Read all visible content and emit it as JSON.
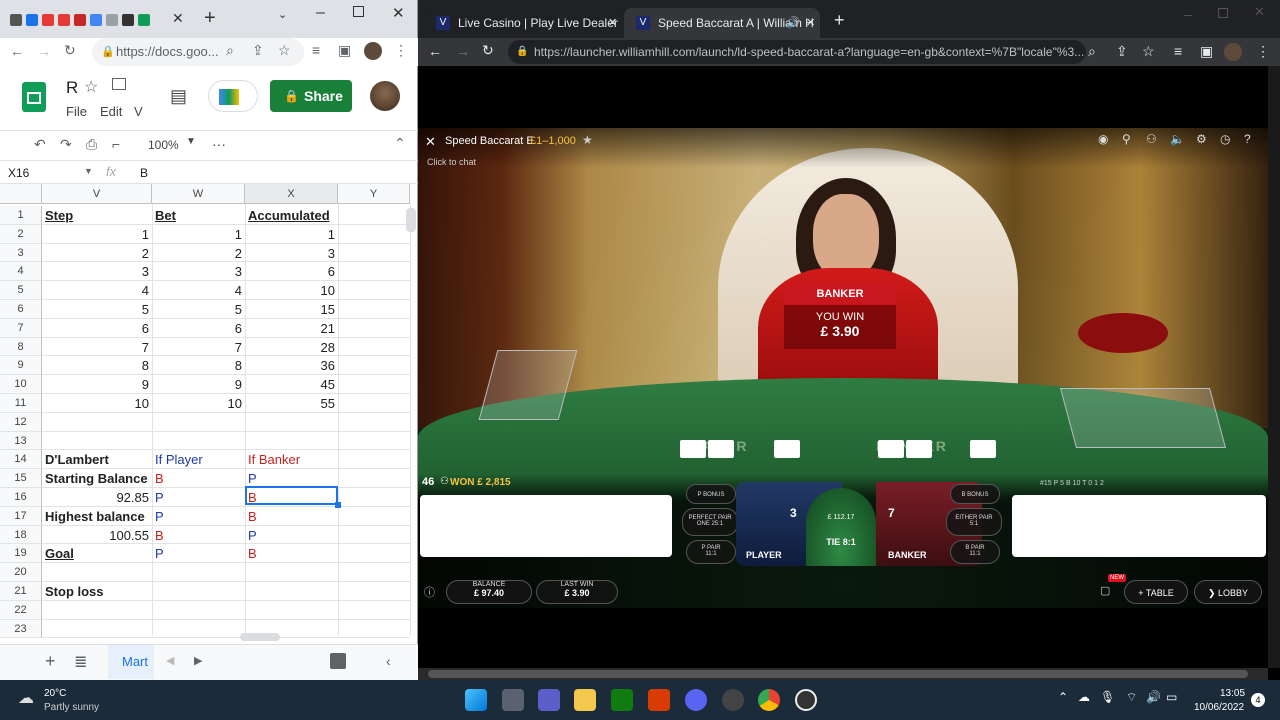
{
  "left_browser": {
    "url": "https://docs.goo...",
    "doc_title": "R",
    "menu": {
      "file": "File",
      "edit": "Edit",
      "more": "V"
    },
    "share_label": "Share",
    "zoom": "100%",
    "more_dots": "···",
    "name_box": "X16",
    "fx": "fx",
    "formula_value": "B",
    "sheet_tab": "Mart"
  },
  "sheet": {
    "columns": [
      "V",
      "W",
      "X",
      "Y"
    ],
    "rows": [
      {
        "n": "1",
        "v": "Step",
        "w": "Bet",
        "x": "Accumulated"
      },
      {
        "n": "2",
        "v": "1",
        "w": "1",
        "x": "1"
      },
      {
        "n": "3",
        "v": "2",
        "w": "2",
        "x": "3"
      },
      {
        "n": "4",
        "v": "3",
        "w": "3",
        "x": "6"
      },
      {
        "n": "5",
        "v": "4",
        "w": "4",
        "x": "10"
      },
      {
        "n": "6",
        "v": "5",
        "w": "5",
        "x": "15"
      },
      {
        "n": "7",
        "v": "6",
        "w": "6",
        "x": "21"
      },
      {
        "n": "8",
        "v": "7",
        "w": "7",
        "x": "28"
      },
      {
        "n": "9",
        "v": "8",
        "w": "8",
        "x": "36"
      },
      {
        "n": "10",
        "v": "9",
        "w": "9",
        "x": "45"
      },
      {
        "n": "11",
        "v": "10",
        "w": "10",
        "x": "55"
      },
      {
        "n": "12",
        "v": "",
        "w": "",
        "x": ""
      },
      {
        "n": "13",
        "v": "",
        "w": "",
        "x": ""
      },
      {
        "n": "14",
        "v": "D'Lambert",
        "w": "If Player",
        "x": "If Banker"
      },
      {
        "n": "15",
        "v": "Starting Balance",
        "w": "B",
        "x": "P"
      },
      {
        "n": "16",
        "v": "92.85",
        "w": "P",
        "x": "B"
      },
      {
        "n": "17",
        "v": "Highest balance",
        "w": "P",
        "x": "B"
      },
      {
        "n": "18",
        "v": "100.55",
        "w": "B",
        "x": "P"
      },
      {
        "n": "19",
        "v": "Goal",
        "w": "P",
        "x": "B"
      },
      {
        "n": "20",
        "v": "",
        "w": "",
        "x": ""
      },
      {
        "n": "21",
        "v": "Stop loss",
        "w": "",
        "x": ""
      },
      {
        "n": "22",
        "v": "",
        "w": "",
        "x": ""
      },
      {
        "n": "23",
        "v": "",
        "w": "",
        "x": ""
      }
    ]
  },
  "right_browser": {
    "tab1": "Live Casino | Play Live Dealer Cas",
    "tab2": "Speed Baccarat A | William H",
    "url": "https://launcher.williamhill.com/launch/ld-speed-baccarat-a?language=en-gb&context=%7B\"locale\"%3..."
  },
  "game": {
    "table_title": "Speed Baccarat E",
    "limits": "£1–1,000",
    "click_chat": "Click to chat",
    "result_label": "BANKER",
    "you_win": "YOU WIN",
    "win_amount": "£ 3.90",
    "won_count": "46",
    "won_label": "WON £ 2,815",
    "player_score": "3",
    "banker_score": "7",
    "player_label": "PLAYER",
    "banker_label": "BANKER",
    "tie_label": "TIE 8:1",
    "tie_amount": "£ 112.17",
    "p_bonus": "P BONUS",
    "b_bonus": "B BONUS",
    "perfect_pair": "PERFECT PAIR",
    "perfect_pair_odds": "ONE 25:1",
    "either_pair": "EITHER PAIR",
    "either_pair_odds": "5:1",
    "p_pair": "P PAIR",
    "p_pair_odds": "11:1",
    "b_pair": "B PAIR",
    "b_pair_odds": "11:1",
    "stats": "#15  P 5  B 10  T 0  1  2",
    "balance_label": "BALANCE",
    "balance_value": "£ 97.40",
    "last_win_label": "LAST WIN",
    "last_win_value": "£ 3.90",
    "new_badge": "NEW",
    "table_btn": "TABLE",
    "lobby_btn": "LOBBY"
  },
  "taskbar": {
    "temp": "20°C",
    "weather": "Partly sunny",
    "time": "13:05",
    "date": "10/06/2022",
    "notif": "4"
  }
}
